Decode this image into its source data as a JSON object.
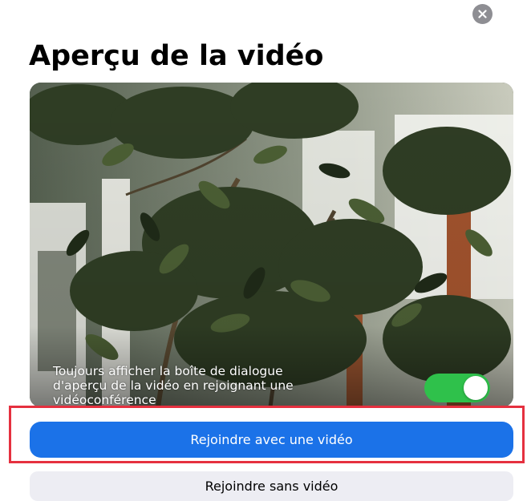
{
  "dialog": {
    "close_icon": "close-icon",
    "title": "Aperçu de la vidéo"
  },
  "preview": {
    "always_show_lines": [
      "Toujours afficher la boîte de dialogue",
      "d'aperçu de la vidéo en rejoignant une",
      "vidéoconférence"
    ],
    "always_show_enabled": true,
    "toggle_on_color": "#2fc14b"
  },
  "actions": {
    "join_with_video_label": "Rejoindre avec une vidéo",
    "join_without_video_label": "Rejoindre sans vidéo",
    "primary_color": "#1b72e8",
    "highlight_color": "#e5303f"
  }
}
